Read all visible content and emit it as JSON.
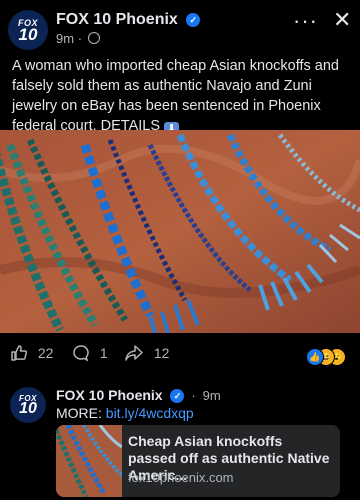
{
  "post": {
    "page_name": "FOX 10 Phoenix",
    "time": "9m",
    "separator": "·",
    "text": "A woman who imported cheap Asian knockoffs and falsely sold them as authentic Navajo and Zuni jewelry on eBay has been sentenced in Phoenix federal court. DETAILS",
    "arrow_emoji": "⬇",
    "logo_fox": "FOX",
    "logo_10": "10",
    "verified": "✓",
    "more_icon": "···",
    "close_icon": "✕"
  },
  "actions": {
    "like_count": "22",
    "comment_count": "1",
    "share_count": "12",
    "reactions": [
      "like",
      "haha",
      "wow"
    ],
    "reaction_glyphs": [
      "👍",
      "😆",
      "😮"
    ]
  },
  "comment": {
    "author": "FOX 10 Phoenix",
    "time": "9m",
    "separator": "·",
    "more_label": "MORE:",
    "link": "bit.ly/4wcdxqp",
    "card_title": "Cheap Asian knockoffs passed off as authentic Native Americ...",
    "card_domain": "fox10phoenix.com"
  },
  "colors": {
    "background": "#000000",
    "link": "#4599ff",
    "verified": "#1877f2",
    "muted_text": "#b0b3b8",
    "card_bg": "#242526"
  }
}
